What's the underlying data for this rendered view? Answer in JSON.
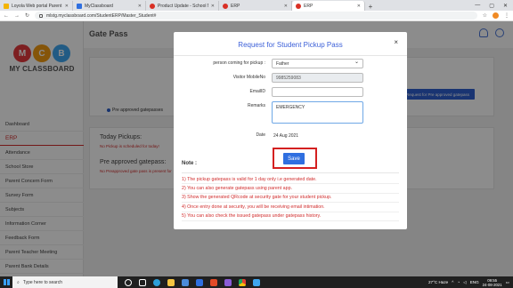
{
  "browser": {
    "tabs": [
      {
        "label": "Loyola Web portal Parent Guide",
        "color": "#f4b400",
        "active": false
      },
      {
        "label": "MyClassboard",
        "color": "#2f6fe0",
        "active": false
      },
      {
        "label": "Product Update - School Manage",
        "color": "#d93025",
        "active": false
      },
      {
        "label": "ERP",
        "color": "#d93025",
        "active": false
      },
      {
        "label": "ERP",
        "color": "#d93025",
        "active": true
      }
    ],
    "new_tab": "+",
    "url": "mlstg.myclassboard.com/StudentERP/Master_Student#"
  },
  "sidebar": {
    "logo_letters": [
      "M",
      "C",
      "B"
    ],
    "logo_colors": [
      "#e4393c",
      "#f39c12",
      "#3fa7f0"
    ],
    "brand": "MY CLASSBOARD",
    "items": [
      "Dashboard",
      "ERP",
      "Attendance",
      "School Store",
      "Parent Concern Form",
      "Survey Form",
      "Subjects",
      "Information Corner",
      "Feedback Form",
      "Parent Teacher Meeting",
      "Parent Bank Details"
    ]
  },
  "header": {
    "title": "Gate Pass"
  },
  "background": {
    "radio_label": "Pre approved gatepasses",
    "request_button": "Request for Pre approved gatepass",
    "today_pickups_title": "Today Pickups:",
    "today_pickups_status": "No Pickup is scheduled for today!",
    "preapproved_title": "Pre approved gatepass:",
    "preapproved_status": "No Preapproved gate pass is present for"
  },
  "modal": {
    "title": "Request for Student Pickup Pass",
    "close": "×",
    "fields": {
      "person_label": "person coming for pickup :",
      "person_value": "Father",
      "mobile_label": "Visitor MobileNo",
      "mobile_value": "9985259083",
      "email_label": "EmailID",
      "email_value": "",
      "remarks_label": "Remarks",
      "remarks_value": "EMERGENCY",
      "date_label": "Date",
      "date_value": "24 Aug 2021"
    },
    "save_label": "Save",
    "note_title": "Note :",
    "notes": [
      "1)  The pickup gatepass is valid for 1 day only i.e generated date.",
      "2)  You can also generate gatepass using parent app.",
      "3)  Show the generated QRcode at security gate for your student pickup.",
      "4)  Once entry done at security, you will be receiving email intimation.",
      "5)  You can also check the issued gatepass under gatepass history."
    ]
  },
  "taskbar": {
    "search_placeholder": "Type here to search",
    "weather": "27°C  Haze",
    "language": "ENG",
    "time": "09:55",
    "date": "24-08-2021"
  }
}
